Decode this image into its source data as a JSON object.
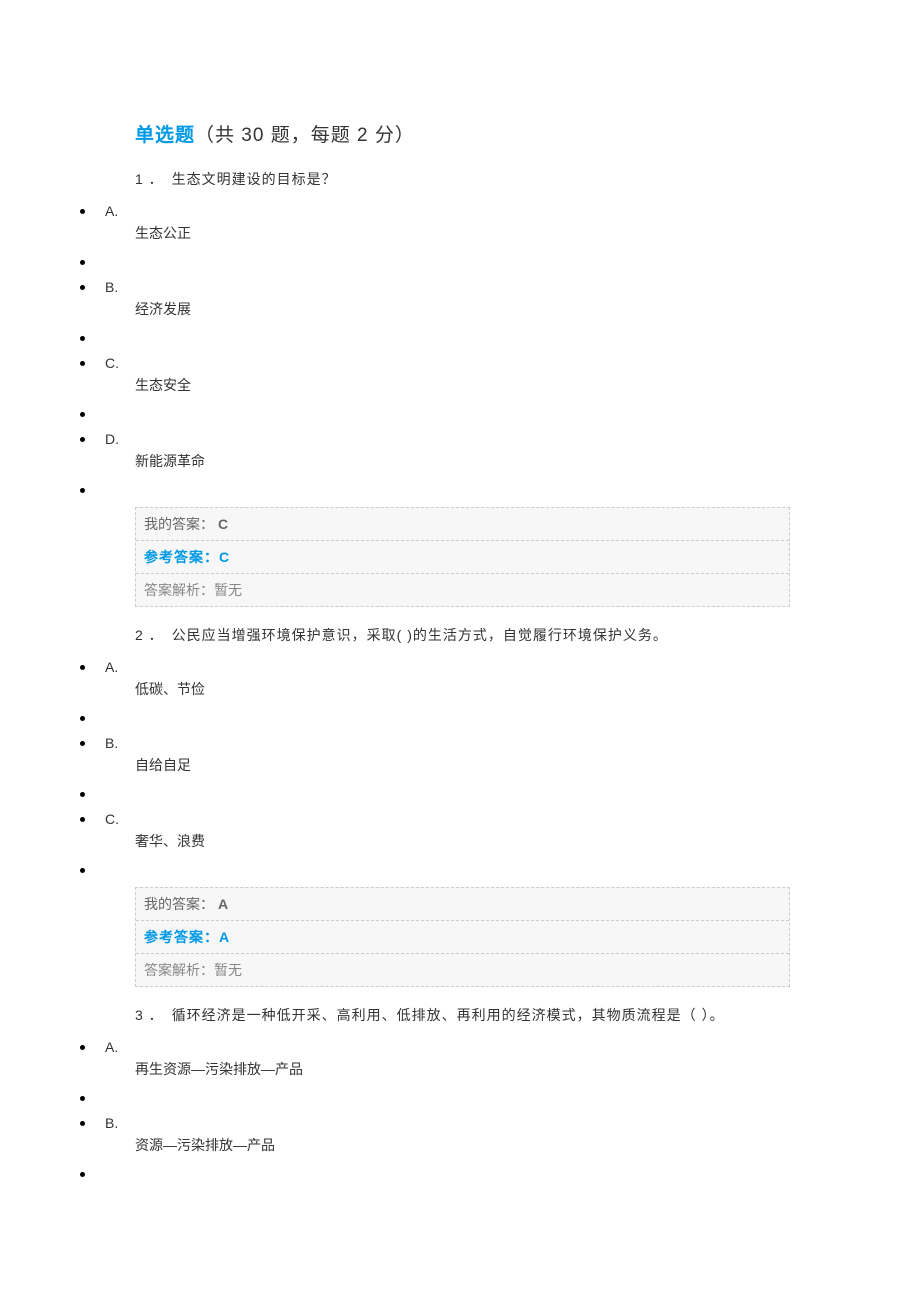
{
  "section": {
    "title_highlight": "单选题",
    "title_rest": "（共 30 题，每题 2 分）"
  },
  "questions": [
    {
      "number": "1 ．",
      "stem": "生态文明建设的目标是？",
      "options": [
        {
          "letter": "A.",
          "text": "生态公正"
        },
        {
          "letter": "B.",
          "text": "经济发展"
        },
        {
          "letter": "C.",
          "text": "生态安全"
        },
        {
          "letter": "D.",
          "text": "新能源革命"
        }
      ],
      "my_answer_label": "我的答案：",
      "my_answer": "C",
      "ref_answer_label": "参考答案：",
      "ref_answer": "C",
      "analysis_label": "答案解析：",
      "analysis": "暂无"
    },
    {
      "number": "2 ．",
      "stem": "公民应当增强环境保护意识，采取( )的生活方式，自觉履行环境保护义务。",
      "options": [
        {
          "letter": "A.",
          "text": "低碳、节俭"
        },
        {
          "letter": "B.",
          "text": "自给自足"
        },
        {
          "letter": "C.",
          "text": "奢华、浪费"
        }
      ],
      "my_answer_label": "我的答案：",
      "my_answer": "A",
      "ref_answer_label": "参考答案：",
      "ref_answer": "A",
      "analysis_label": "答案解析：",
      "analysis": "暂无"
    },
    {
      "number": "3 ．",
      "stem": "循环经济是一种低开采、高利用、低排放、再利用的经济模式，其物质流程是（ ）。",
      "options": [
        {
          "letter": "A.",
          "text": "再生资源—污染排放—产品"
        },
        {
          "letter": "B.",
          "text": "资源—污染排放—产品"
        }
      ],
      "my_answer_label": null,
      "my_answer": null,
      "ref_answer_label": null,
      "ref_answer": null,
      "analysis_label": null,
      "analysis": null
    }
  ]
}
